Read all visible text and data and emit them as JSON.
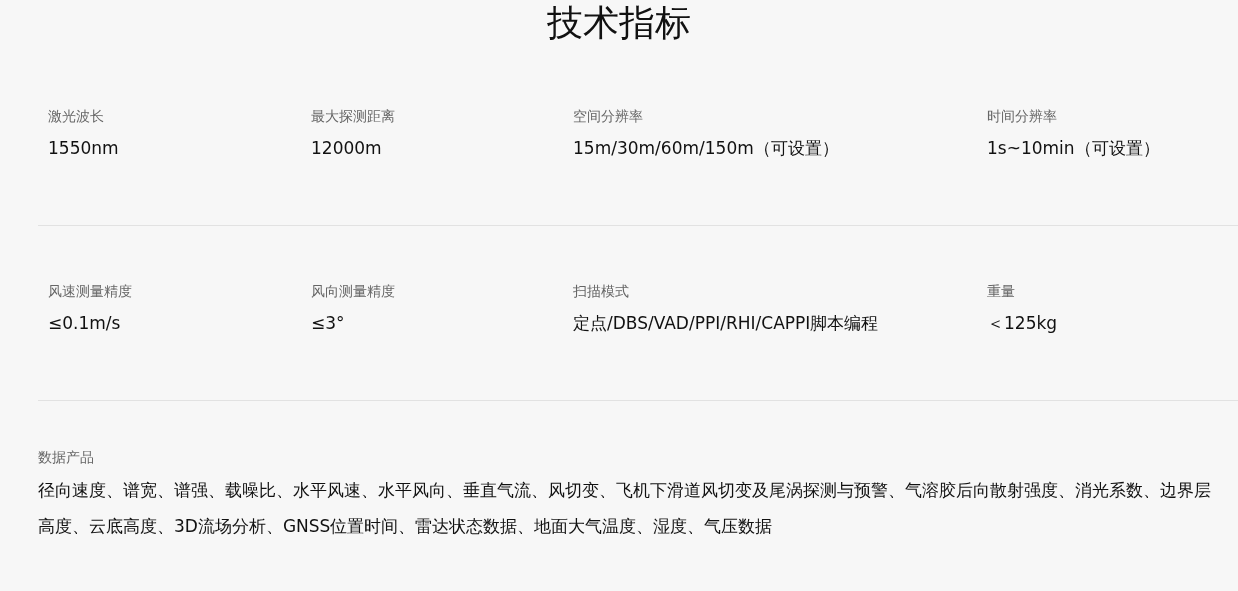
{
  "title": "技术指标",
  "spec_rows": [
    [
      {
        "label": "激光波长",
        "value": "1550nm"
      },
      {
        "label": "最大探测距离",
        "value": "12000m"
      },
      {
        "label": "空间分辨率",
        "value": "15m/30m/60m/150m（可设置）"
      },
      {
        "label": "时间分辨率",
        "value": "1s~10min（可设置）"
      }
    ],
    [
      {
        "label": "风速测量精度",
        "value": "≤0.1m/s"
      },
      {
        "label": "风向测量精度",
        "value": "≤3°"
      },
      {
        "label": "扫描模式",
        "value": "定点/DBS/VAD/PPI/RHI/CAPPI脚本编程"
      },
      {
        "label": "重量",
        "value": "＜125kg"
      }
    ]
  ],
  "data_products": {
    "label": "数据产品",
    "text": "径向速度、谱宽、谱强、载噪比、水平风速、水平风向、垂直气流、风切变、飞机下滑道风切变及尾涡探测与预警、气溶胶后向散射强度、消光系数、边界层高度、云底高度、3D流场分析、GNSS位置时间、雷达状态数据、地面大气温度、湿度、气压数据"
  }
}
